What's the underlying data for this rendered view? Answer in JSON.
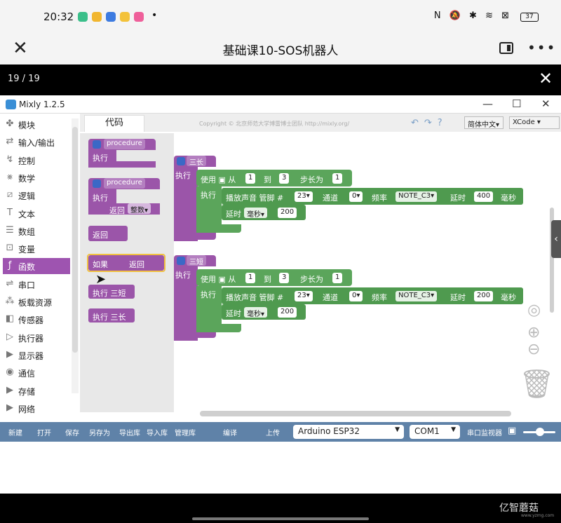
{
  "status": {
    "time": "20:32",
    "dot": "•",
    "right": "N 🔕 ✱ ≋ ⊠",
    "battery": "37"
  },
  "titlebar": {
    "title": "基础课10-SOS机器人"
  },
  "viewer": {
    "pages": "19 / 19"
  },
  "window": {
    "title": "Mixly 1.2.5",
    "min": "—",
    "max": "☐",
    "close": "✕"
  },
  "header": {
    "code_tab": "代码",
    "copyright": "Copyright © 北京师范大学博雷博士团队 http://mixly.org/",
    "language": "简体中文▾",
    "theme": "XCode"
  },
  "categories": [
    {
      "label": "模块",
      "icon": "puzzle-icon"
    },
    {
      "label": "输入/输出",
      "icon": "io-icon"
    },
    {
      "label": "控制",
      "icon": "control-icon"
    },
    {
      "label": "数学",
      "icon": "math-icon"
    },
    {
      "label": "逻辑",
      "icon": "logic-icon"
    },
    {
      "label": "文本",
      "icon": "text-icon"
    },
    {
      "label": "数组",
      "icon": "list-icon"
    },
    {
      "label": "变量",
      "icon": "variable-icon"
    },
    {
      "label": "函数",
      "icon": "function-icon"
    },
    {
      "label": "串口",
      "icon": "serial-icon"
    },
    {
      "label": "板载资源",
      "icon": "board-icon"
    },
    {
      "label": "传感器",
      "icon": "sensor-icon"
    },
    {
      "label": "执行器",
      "icon": "actuator-icon"
    },
    {
      "label": "显示器",
      "icon": "display-icon"
    },
    {
      "label": "通信",
      "icon": "comm-icon"
    },
    {
      "label": "存储",
      "icon": "storage-icon"
    },
    {
      "label": "网络",
      "icon": "network-icon"
    }
  ],
  "flyout": {
    "procedure": "procedure",
    "exec": "执行",
    "return": "返回",
    "int_type": "整数▾",
    "if": "如果",
    "call_short": "执行  三短",
    "call_long": "执行  三长"
  },
  "blocks": {
    "long": {
      "name": "三长",
      "exec": "执行",
      "loop": "使用",
      "from": "从",
      "from_val": "1",
      "to": "到",
      "to_val": "3",
      "step": "步长为",
      "step_val": "1",
      "do": "执行",
      "tone": "播放声音 管脚 #",
      "pin": "23▾",
      "channel_lbl": "通道",
      "channel": "0▾",
      "freq_lbl": "频率",
      "note": "NOTE_C3▾",
      "delay_lbl": "延时",
      "duration": "400",
      "ms_lbl": "毫秒",
      "delay2_lbl": "延时",
      "unit": "毫秒▾",
      "delay2": "200"
    },
    "short": {
      "name": "三短",
      "exec": "执行",
      "loop": "使用",
      "from": "从",
      "from_val": "1",
      "to": "到",
      "to_val": "3",
      "step": "步长为",
      "step_val": "1",
      "do": "执行",
      "tone": "播放声音 管脚 #",
      "pin": "23▾",
      "channel_lbl": "通道",
      "channel": "0▾",
      "freq_lbl": "频率",
      "note": "NOTE_C3▾",
      "delay_lbl": "延时",
      "duration": "200",
      "ms_lbl": "毫秒",
      "delay2_lbl": "延时",
      "unit": "毫秒▾",
      "delay2": "200"
    }
  },
  "toolbar": {
    "new": "新建",
    "open": "打开",
    "save": "保存",
    "save_as": "另存为",
    "export_lib": "导出库",
    "import_lib": "导入库",
    "manage_lib": "管理库",
    "compile": "编译",
    "upload": "上传",
    "board": "Arduino ESP32",
    "port": "COM1",
    "monitor": "串口监视器"
  },
  "footer": {
    "logo": "亿智蘑菇",
    "url": "www.yzmg.com"
  }
}
